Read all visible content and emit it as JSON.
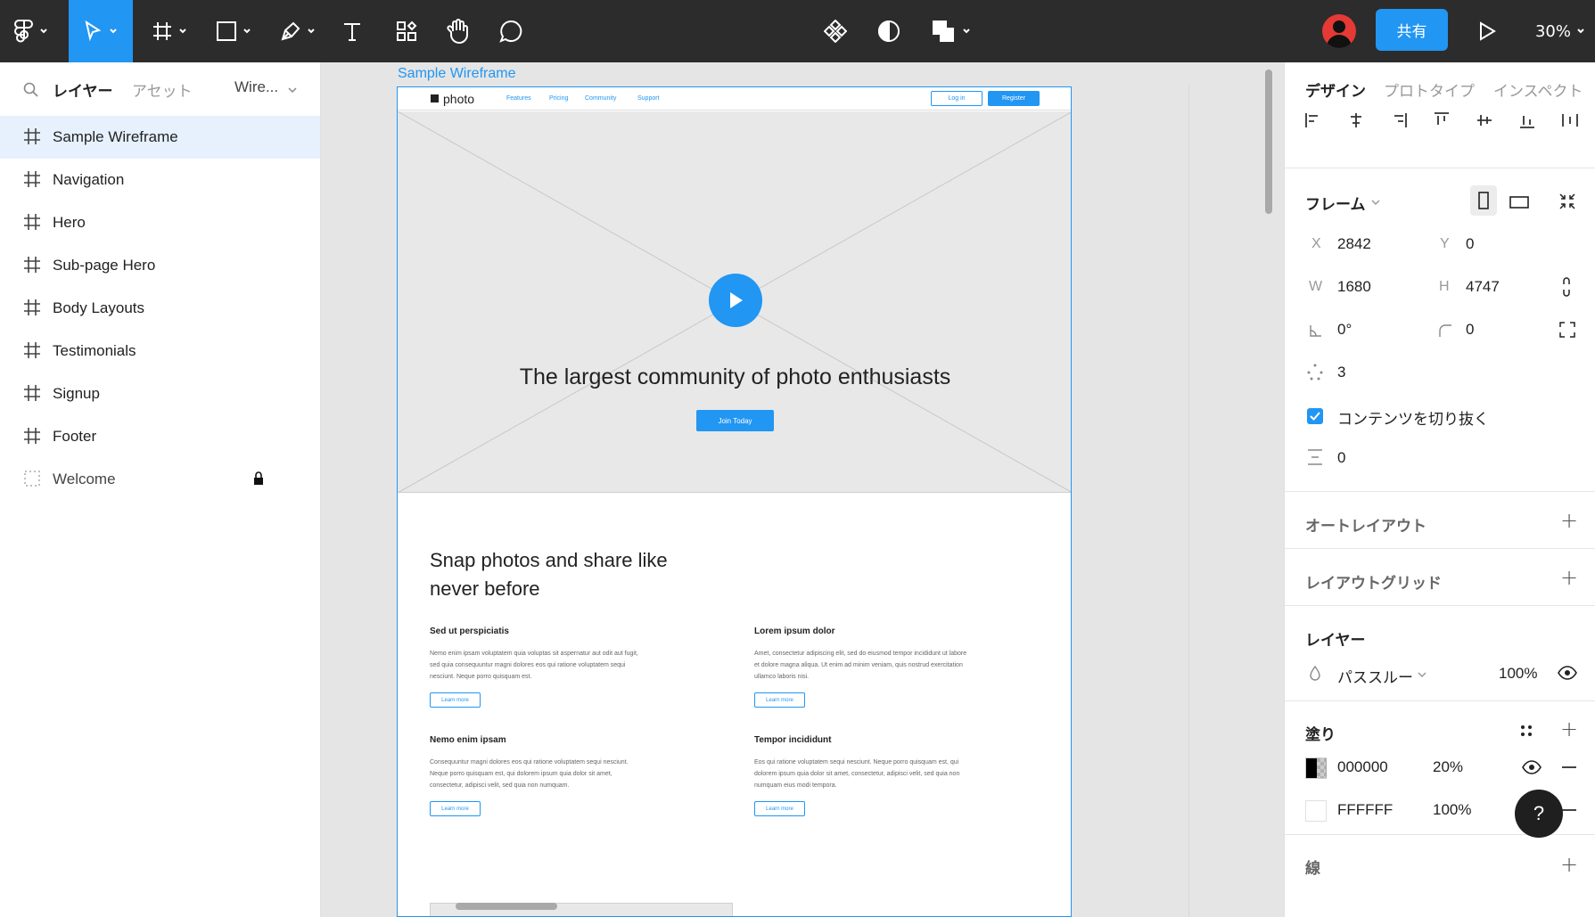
{
  "toolbar": {
    "share_label": "共有",
    "zoom": "30%",
    "accent": "#2196f3"
  },
  "left_panel": {
    "tabs": {
      "layers": "レイヤー",
      "assets": "アセット",
      "page": "Wire..."
    },
    "layers": [
      {
        "label": "Sample Wireframe",
        "type": "frame",
        "selected": true
      },
      {
        "label": "Navigation",
        "type": "frame"
      },
      {
        "label": "Hero",
        "type": "frame"
      },
      {
        "label": "Sub-page Hero",
        "type": "frame"
      },
      {
        "label": "Body Layouts",
        "type": "frame"
      },
      {
        "label": "Testimonials",
        "type": "frame"
      },
      {
        "label": "Signup",
        "type": "frame"
      },
      {
        "label": "Footer",
        "type": "frame"
      },
      {
        "label": "Welcome",
        "type": "section",
        "locked": true
      }
    ]
  },
  "canvas": {
    "frame_label": "Sample Wireframe",
    "nav": {
      "logo": "photo",
      "links": [
        "Features",
        "Pricing",
        "Community",
        "Support"
      ],
      "login": "Log in",
      "register": "Register"
    },
    "hero": {
      "headline": "The largest community of photo enthusiasts",
      "cta": "Join Today"
    },
    "body": {
      "heading_line1": "Snap photos and share like",
      "heading_line2": "never before",
      "items": [
        {
          "title": "Sed ut perspiciatis",
          "lines": [
            "Nemo enim ipsam voluptatem quia voluptas sit aspernatur aut odit aut fugit,",
            "sed quia consequuntur magni dolores eos qui ratione voluptatem sequi",
            "nesciunt. Neque porro quisquam est."
          ],
          "link": "Learn more"
        },
        {
          "title": "Lorem ipsum dolor",
          "lines": [
            "Amet, consectetur adipiscing elit, sed do eiusmod tempor incididunt ut labore",
            "et dolore magna aliqua. Ut enim ad minim veniam, quis nostrud exercitation",
            "ullamco laboris nisi."
          ],
          "link": "Learn more"
        },
        {
          "title": "Nemo enim ipsam",
          "lines": [
            "Consequuntur magni dolores eos qui ratione voluptatem sequi nesciunt.",
            "Neque porro quisquam est, qui dolorem ipsum quia dolor sit amet,",
            "consectetur, adipisci velit, sed quia non numquam."
          ],
          "link": "Learn more"
        },
        {
          "title": "Tempor incididunt",
          "lines": [
            "Eos qui ratione voluptatem sequi nesciunt. Neque porro quisquam est, qui",
            "dolorem ipsum quia dolor sit amet, consectetur, adipisci velit, sed quia non",
            "numquam eius modi tempora."
          ],
          "link": "Learn more"
        }
      ]
    }
  },
  "right_panel": {
    "tabs": {
      "design": "デザイン",
      "prototype": "プロトタイプ",
      "inspect": "インスペクト"
    },
    "frame": {
      "title": "フレーム",
      "x_label": "X",
      "x": "2842",
      "y_label": "Y",
      "y": "0",
      "w_label": "W",
      "w": "1680",
      "h_label": "H",
      "h": "4747",
      "rotation": "0°",
      "radius": "0",
      "points": "3",
      "clip_label": "コンテンツを切り抜く",
      "spacing": "0"
    },
    "auto_layout": "オートレイアウト",
    "layout_grid": "レイアウトグリッド",
    "layer": {
      "title": "レイヤー",
      "blend": "パススルー",
      "opacity": "100%"
    },
    "fill": {
      "title": "塗り",
      "items": [
        {
          "hex": "000000",
          "opacity": "20%",
          "swatch": "#000000"
        },
        {
          "hex": "FFFFFF",
          "opacity": "100%",
          "swatch": "#ffffff"
        }
      ]
    },
    "stroke_title": "線",
    "help": "?"
  }
}
